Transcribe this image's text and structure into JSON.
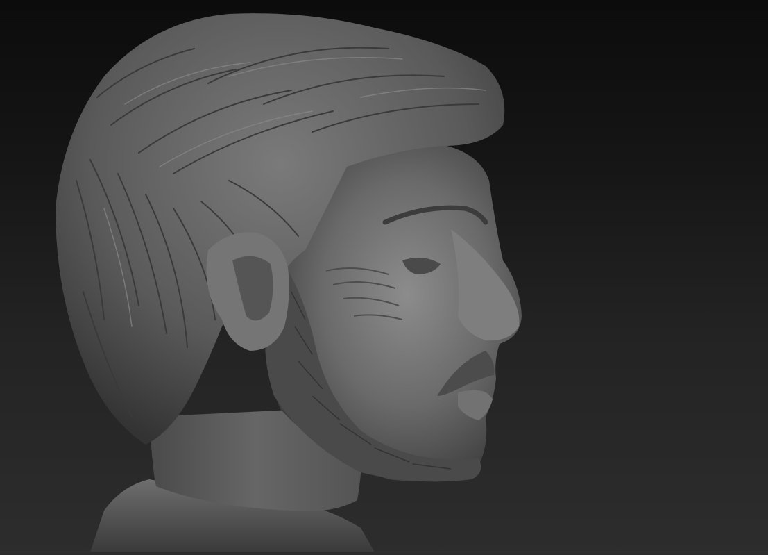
{
  "viewport": {
    "background_top": "#0c0c0c",
    "background_bottom": "#2d2d2d",
    "frame_line": "#5a5a5a"
  },
  "model": {
    "material": "gray-clay",
    "base_color": "#6b6b6b",
    "highlight_color": "#9a9a9a",
    "shadow_color": "#2e2e2e",
    "icon": "sculpt-head-icon"
  }
}
